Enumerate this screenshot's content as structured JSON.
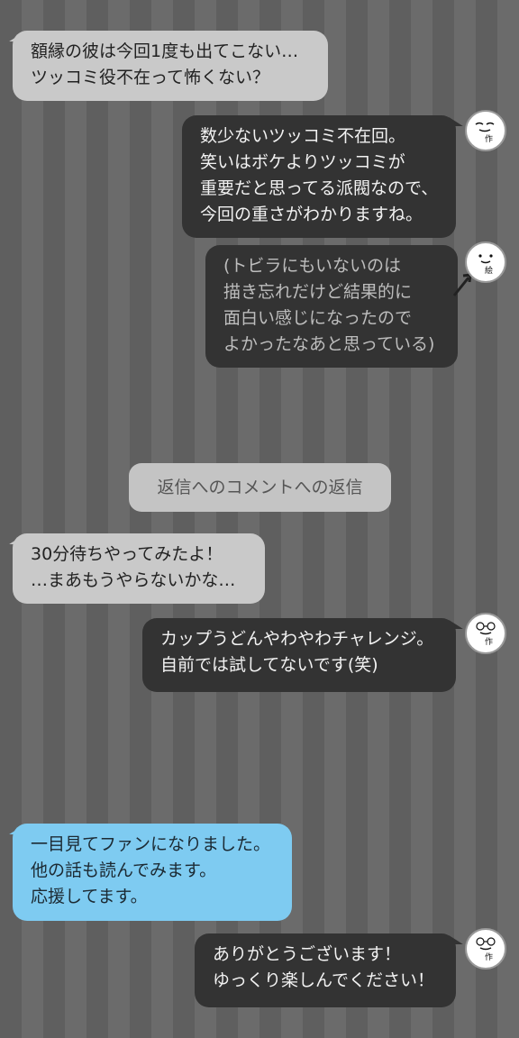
{
  "thread": {
    "messages": [
      {
        "lines": [
          "額縁の彼は今回1度も出てこない…",
          "ツッコミ役不在って怖くない？"
        ]
      },
      {
        "lines": [
          "数少ないツッコミ不在回。",
          "笑いはボケよりツッコミが",
          "重要だと思ってる派閥なので、",
          "今回の重さがわかりますね。"
        ],
        "avatar_tag": "作"
      },
      {
        "lines": [
          "(トビラにもいないのは",
          "描き忘れだけど結果的に",
          "面白い感じになったので",
          "よかったなあと思っている)"
        ],
        "avatar_tag": "絵"
      }
    ],
    "divider": "返信へのコメントへの返信",
    "messages2": [
      {
        "lines": [
          "30分待ちやってみたよ！",
          "…まあもうやらないかな…"
        ]
      },
      {
        "lines": [
          "カップうどんやわやわチャレンジ。",
          "自前では試してないです(笑)"
        ],
        "avatar_tag": "作"
      },
      {
        "lines": [
          "一目見てファンになりました。",
          "他の話も読んでみます。",
          "応援してます。"
        ]
      },
      {
        "lines": [
          "ありがとうございます！",
          "ゆっくり楽しんでください！"
        ],
        "avatar_tag": "作"
      }
    ]
  },
  "colors": {
    "reader_bubble": "#c9c9c9",
    "author_bubble": "#333333",
    "fan_bubble": "#7ecbf1",
    "stripe_dark": "#5f5f5f",
    "stripe_light": "#6b6b6b"
  }
}
